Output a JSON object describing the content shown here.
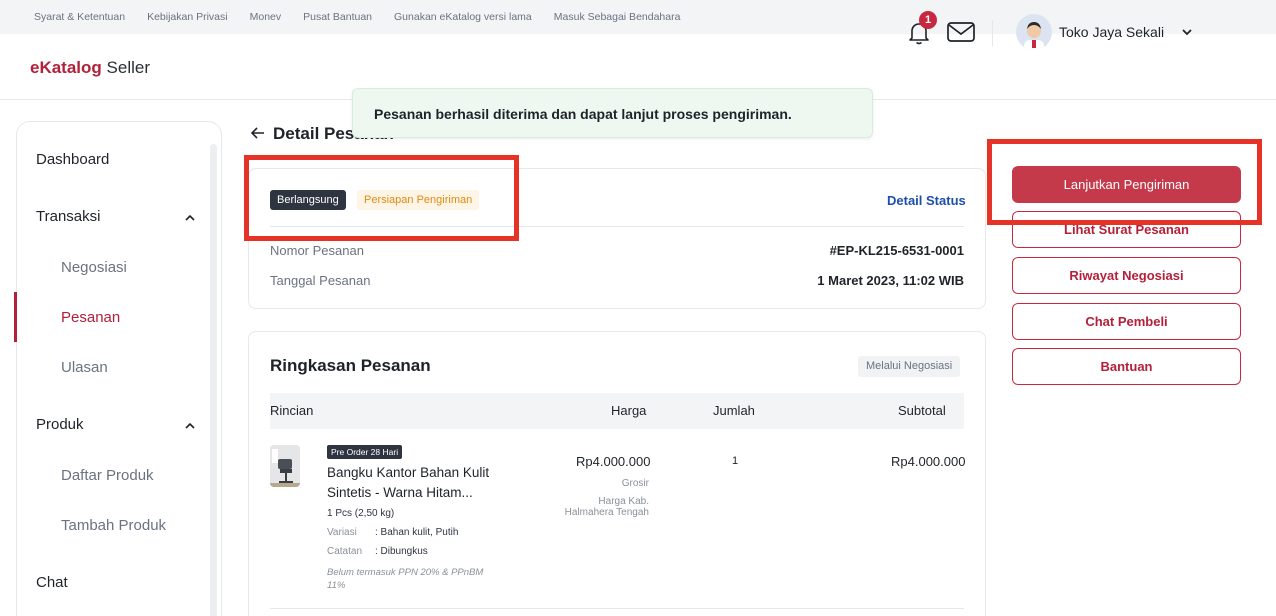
{
  "topbar": {
    "links": [
      "Syarat & Ketentuan",
      "Kebijakan Privasi",
      "Monev",
      "Pusat Bantuan",
      "Gunakan eKatalog versi lama",
      "Masuk Sebagai Bendahara"
    ]
  },
  "header": {
    "logo_brand": "eKatalog",
    "logo_suffix": " Seller",
    "notification_count": "1",
    "store_name": "Toko Jaya Sekali"
  },
  "sidebar": {
    "dashboard": "Dashboard",
    "transaksi": "Transaksi",
    "negosiasi": "Negosiasi",
    "pesanan": "Pesanan",
    "ulasan": "Ulasan",
    "produk": "Produk",
    "daftar_produk": "Daftar Produk",
    "tambah_produk": "Tambah Produk",
    "chat": "Chat"
  },
  "page": {
    "title": "Detail Pesanan"
  },
  "toast": {
    "message": "Pesanan berhasil diterima dan dapat lanjut proses pengiriman."
  },
  "order_info": {
    "status_badge": "Berlangsung",
    "substatus_badge": "Persiapan Pengiriman",
    "detail_status_link": "Detail Status",
    "order_number_label": "Nomor Pesanan",
    "order_number": "#EP-KL215-6531-0001",
    "order_date_label": "Tanggal Pesanan",
    "order_date": "1 Maret 2023, 11:02 WIB"
  },
  "summary": {
    "title": "Ringkasan Pesanan",
    "via_badge": "Melalui Negosiasi",
    "columns": [
      "Rincian",
      "Harga",
      "Jumlah",
      "Subtotal"
    ],
    "item": {
      "preorder_badge": "Pre Order 28 Hari",
      "name": "Bangku Kantor Bahan Kulit Sintetis - Warna Hitam...",
      "qty_weight": "1 Pcs (2,50 kg)",
      "variant_label": "Variasi",
      "variant_value": ": Bahan kulit, Putih",
      "note_label": "Catatan",
      "note_value": ": Dibungkus",
      "tax_note": "Belum termasuk PPN 20% & PPnBM 11%",
      "price": "Rp4.000.000",
      "price_type": "Grosir",
      "price_region": "Harga Kab. Halmahera Tengah",
      "quantity": "1",
      "subtotal": "Rp4.000.000"
    }
  },
  "actions": {
    "continue_shipping": "Lanjutkan Pengiriman",
    "view_order_letter": "Lihat Surat Pesanan",
    "negotiation_history": "Riwayat Negosiasi",
    "chat_buyer": "Chat Pembeli",
    "help": "Bantuan"
  },
  "colors": {
    "brand": "#b3203a",
    "primary_button": "#c53a4b",
    "highlight": "#e53427",
    "toast_bg": "#eef8f1",
    "link": "#1e4fa8"
  }
}
